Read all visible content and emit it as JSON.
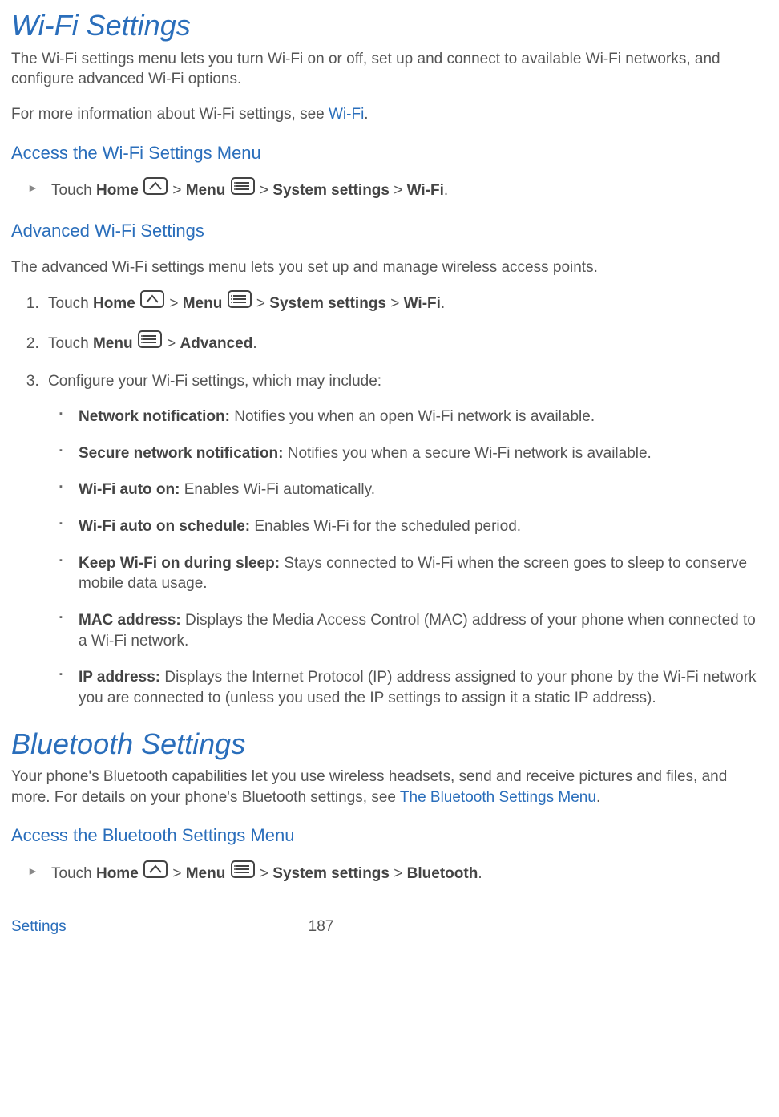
{
  "wifi": {
    "heading": "Wi-Fi Settings",
    "intro": "The Wi-Fi settings menu lets you turn Wi-Fi on or off, set up and connect to available Wi-Fi networks, and configure advanced Wi-Fi options.",
    "more_info_prefix": "For more information about Wi-Fi settings, see ",
    "more_info_link": "Wi-Fi",
    "more_info_suffix": ".",
    "access_heading": "Access the Wi-Fi Settings Menu",
    "access_step": {
      "touch": "Touch ",
      "home": "Home",
      "menu": "Menu",
      "syssettings": "System settings",
      "wifi": "Wi-Fi",
      "gt": " > "
    },
    "advanced_heading": "Advanced Wi-Fi Settings",
    "advanced_intro": "The advanced Wi-Fi settings menu lets you set up and manage wireless access points.",
    "step2": {
      "touch": "Touch ",
      "menu": "Menu",
      "gt": " > ",
      "advanced": "Advanced",
      "dot": "."
    },
    "step3": "Configure your Wi-Fi settings, which may include:",
    "bullets": [
      {
        "label": "Network notification:",
        "text": " Notifies you when an open Wi-Fi network is available."
      },
      {
        "label": "Secure network notification:",
        "text": " Notifies you when a secure Wi-Fi network is available."
      },
      {
        "label": "Wi-Fi auto on:",
        "text": " Enables Wi-Fi automatically."
      },
      {
        "label": "Wi-Fi auto on schedule:",
        "text": " Enables Wi-Fi for the scheduled period."
      },
      {
        "label": "Keep Wi-Fi on during sleep:",
        "text": " Stays connected to Wi-Fi when the screen goes to sleep to conserve mobile data usage."
      },
      {
        "label": "MAC address:",
        "text": " Displays the Media Access Control (MAC) address of your phone when connected to a Wi-Fi network."
      },
      {
        "label": "IP address:",
        "text": " Displays the Internet Protocol (IP) address assigned to your phone by the Wi-Fi network you are connected to (unless you used the IP settings to assign it a static IP address)."
      }
    ]
  },
  "bluetooth": {
    "heading": "Bluetooth Settings",
    "intro_prefix": "Your phone's Bluetooth capabilities let you use wireless headsets, send and receive pictures and files, and more. For details on your phone's Bluetooth settings, see ",
    "intro_link": "The Bluetooth Settings Menu",
    "intro_suffix": ".",
    "access_heading": "Access the Bluetooth Settings Menu",
    "step": {
      "touch": "Touch ",
      "home": "Home",
      "menu": "Menu",
      "gt": " > ",
      "syssettings": "System settings",
      "bluetooth": "Bluetooth",
      "dot": "."
    }
  },
  "footer": {
    "section": "Settings",
    "page": "187"
  }
}
